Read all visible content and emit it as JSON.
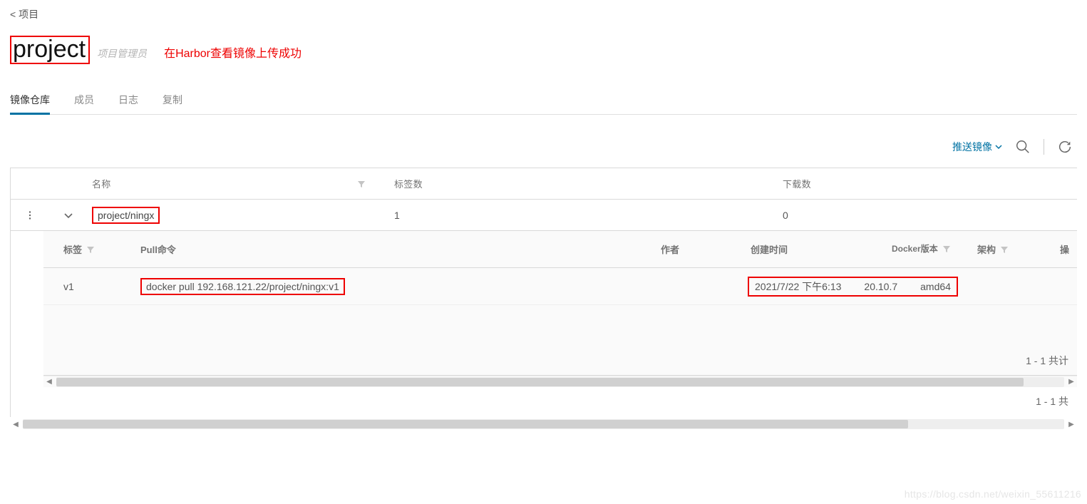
{
  "breadcrumb": {
    "back_label": "项目"
  },
  "title": {
    "project_name": "project",
    "role": "项目管理员"
  },
  "annotation": "在Harbor查看镜像上传成功",
  "tabs": {
    "repositories": "镜像仓库",
    "members": "成员",
    "logs": "日志",
    "replication": "复制"
  },
  "toolbar": {
    "push_image": "推送镜像"
  },
  "outer_table": {
    "headers": {
      "name": "名称",
      "tags": "标签数",
      "downloads": "下载数"
    },
    "rows": [
      {
        "name": "project/ningx",
        "tags": "1",
        "downloads": "0"
      }
    ],
    "footer": "1 - 1 共"
  },
  "inner_table": {
    "headers": {
      "tag": "标签",
      "pull": "Pull命令",
      "author": "作者",
      "created": "创建时间",
      "docker": "Docker版本",
      "arch": "架构",
      "ops": "操"
    },
    "rows": [
      {
        "tag": "v1",
        "pull": "docker pull 192.168.121.22/project/ningx:v1",
        "author": "",
        "created": "2021/7/22 下午6:13",
        "docker": "20.10.7",
        "arch": "amd64"
      }
    ],
    "footer": "1 - 1 共计"
  },
  "watermark": "https://blog.csdn.net/weixin_55611216"
}
